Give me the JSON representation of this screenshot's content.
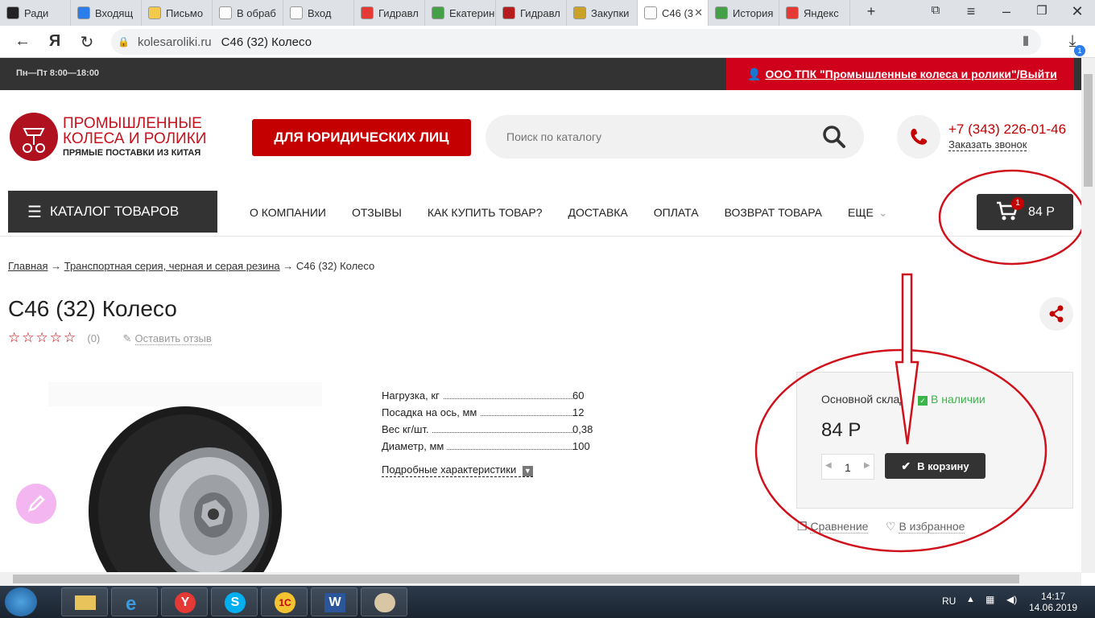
{
  "browser": {
    "tabs": [
      {
        "label": "Ради",
        "color": "#222"
      },
      {
        "label": "Входящ",
        "color": "#2b7de9"
      },
      {
        "label": "Письмо",
        "color": "#f2c94c"
      },
      {
        "label": "В обраб",
        "color": "#ffffff"
      },
      {
        "label": "Вход",
        "color": "#ffffff"
      },
      {
        "label": "Гидравл",
        "color": "#e53935"
      },
      {
        "label": "Екатерин",
        "color": "#43a047"
      },
      {
        "label": "Гидравл",
        "color": "#b71c1c"
      },
      {
        "label": "Закупки",
        "color": "#c9a227"
      },
      {
        "label": "С46 (3",
        "color": "#ffffff"
      },
      {
        "label": "История",
        "color": "#43a047"
      },
      {
        "label": "Яндекс",
        "color": "#e53935"
      }
    ],
    "new_tab": "+",
    "url_domain": "kolesaroliki.ru",
    "url_title": "С46 (32) Колесо",
    "download_badge": "1"
  },
  "topbar": {
    "hours": "Пн—Пт 8:00—18:00",
    "company": "ООО ТПК \"Промышленные колеса и ролики\"",
    "separator": " / ",
    "logout": "Выйти"
  },
  "header": {
    "logo_line1": "ПРОМЫШЛЕННЫЕ КОЛЕСА И РОЛИКИ",
    "logo_line2": "ПРЯМЫЕ ПОСТАВКИ ИЗ КИТАЯ",
    "legal_button": "ДЛЯ ЮРИДИЧЕСКИХ ЛИЦ",
    "search_placeholder": "Поиск по каталогу",
    "phone": "+7 (343) 226-01-46",
    "callback": "Заказать звонок"
  },
  "nav": {
    "catalog": "КАТАЛОГ ТОВАРОВ",
    "items": [
      "О КОМПАНИИ",
      "ОТЗЫВЫ",
      "КАК КУПИТЬ ТОВАР?",
      "ДОСТАВКА",
      "ОПЛАТА",
      "ВОЗВРАТ ТОВАРА",
      "ЕЩЕ"
    ],
    "cart_count": "1",
    "cart_total": "84 Р"
  },
  "breadcrumb": {
    "home": "Главная",
    "arrow": "→",
    "category": "Транспортная серия, черная и серая резина",
    "current": "С46 (32) Колесо"
  },
  "product": {
    "title": "С46 (32) Колесо",
    "stars": "☆☆☆☆☆",
    "reviews_count": "(0)",
    "leave_review": "Оставить отзыв",
    "specs": [
      {
        "label": "Нагрузка, кг",
        "value": "60"
      },
      {
        "label": "Посадка на ось, мм",
        "value": "12"
      },
      {
        "label": "Вес кг/шт.",
        "value": "0,38"
      },
      {
        "label": "Диаметр, мм",
        "value": "100"
      }
    ],
    "more_specs": "Подробные характеристики"
  },
  "buybox": {
    "warehouse": "Основной склад",
    "stock_status": "В наличии",
    "price": "84 Р",
    "quantity": "1",
    "add_to_cart": "В корзину",
    "compare": "Сравнение",
    "favorite": "В избранное"
  },
  "taskbar": {
    "lang": "RU",
    "time": "14:17",
    "date": "14.06.2019"
  },
  "colors": {
    "brand_red": "#c40000",
    "dark": "#333333",
    "stock_green": "#3ab54a",
    "annotation_red": "#d0101a"
  }
}
